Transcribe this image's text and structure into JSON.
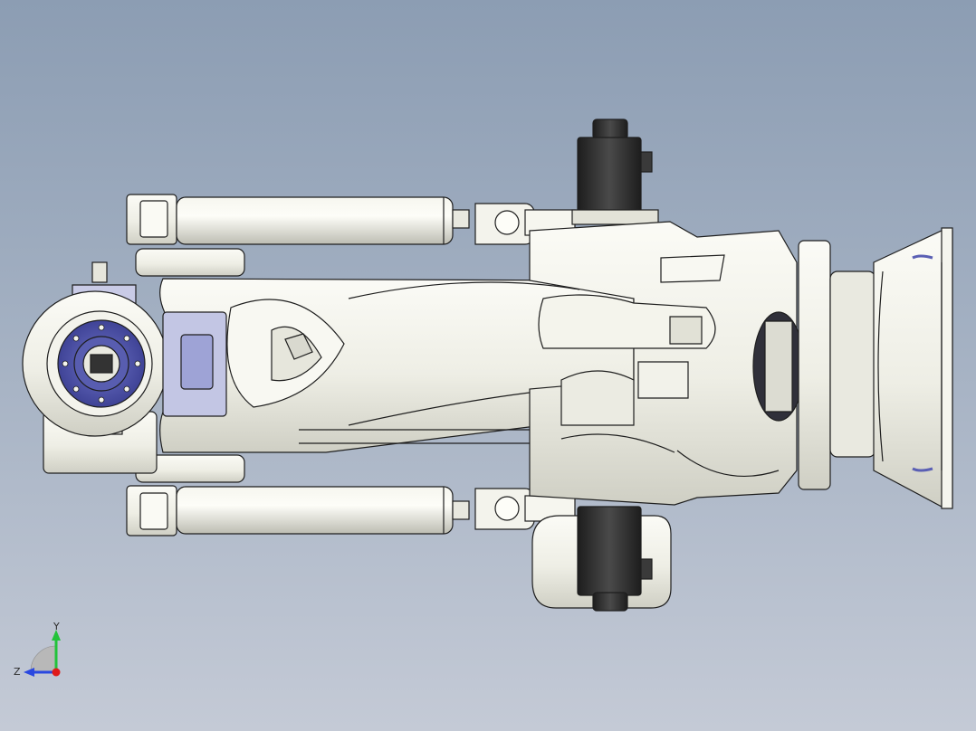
{
  "viewport": {
    "background_top": "#8c9db3",
    "background_bottom": "#c4cad6"
  },
  "model": {
    "body_color": "#f1f1ea",
    "edge_color": "#1e1e1e",
    "accent_color": "#5a5fb4",
    "motor_color": "#2e2e2e"
  },
  "triad": {
    "y_label": "Y",
    "z_label": "Z",
    "y_color": "#22c33a",
    "z_color": "#2a48e0",
    "origin_color": "#e01a1a"
  }
}
